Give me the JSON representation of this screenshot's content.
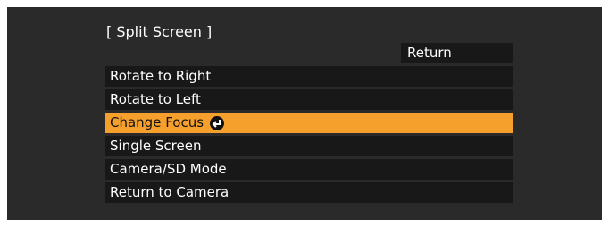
{
  "menu": {
    "title": "[ Split Screen ]",
    "return_label": "Return",
    "items": [
      {
        "label": "Rotate to Right"
      },
      {
        "label": "Rotate to Left"
      },
      {
        "label": "Change Focus",
        "selected": true,
        "icon": "enter-icon"
      },
      {
        "label": "Single Screen"
      },
      {
        "label": "Camera/SD Mode"
      },
      {
        "label": "Return to Camera"
      }
    ]
  },
  "colors": {
    "background": "#2a2a2a",
    "item_background": "#181818",
    "highlight": "#f5a02d"
  }
}
